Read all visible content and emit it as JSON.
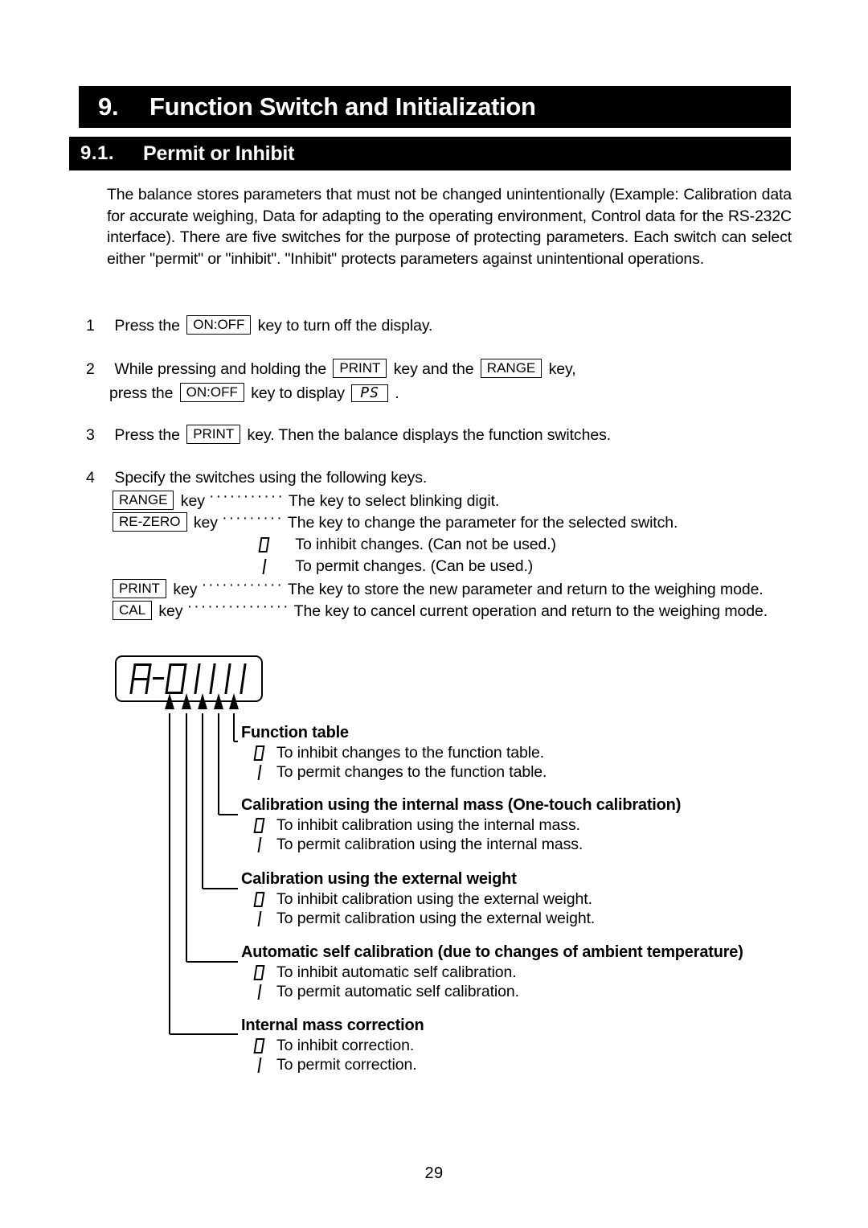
{
  "chapter": {
    "number": "9.",
    "title": "Function Switch and Initialization"
  },
  "section": {
    "number": "9.1.",
    "title": "Permit or Inhibit"
  },
  "intro": {
    "text": "The balance stores parameters that must not be changed unintentionally (Example: Calibration data for accurate weighing, Data for adapting to the operating environment, Control data for the RS-232C interface). There are five switches for the purpose of protecting parameters. Each switch can select either \"permit\" or \"inhibit\". \"Inhibit\" protects parameters against unintentional operations."
  },
  "steps": [
    {
      "number": "1",
      "pre": "Press the",
      "key1": "ON:OFF",
      "post": "key to turn off the display."
    },
    {
      "number": "2",
      "line1_pre": "While pressing and holding the",
      "line1_key1": "PRINT",
      "line1_mid": "key and the",
      "line1_key2": "RANGE",
      "line1_post": "key,",
      "line2_pre": "press the",
      "line2_key1": "ON:OFF",
      "line2_mid": "key to display",
      "line2_display": "PS",
      "line2_post": "."
    },
    {
      "number": "3",
      "pre": "Press the",
      "key1": "PRINT",
      "post": "key. Then the balance displays the function switches."
    },
    {
      "number": "4",
      "intro": "Specify the switches using the following keys."
    }
  ],
  "key_descriptions": [
    {
      "key": "RANGE",
      "word": "key",
      "leader": "···········",
      "text": "The key to select blinking digit."
    },
    {
      "key": "RE-ZERO",
      "word": "key",
      "leader": "·········",
      "text": "The key to change the parameter for the selected switch."
    },
    {
      "key": "PRINT",
      "word": "key",
      "leader": "············",
      "text": "The key to store the new parameter and return to the weighing mode."
    },
    {
      "key": "CAL",
      "word": "key",
      "leader": "···············",
      "text": "The key to cancel current operation and return to the weighing mode."
    }
  ],
  "rezero_options": [
    {
      "glyph": "0",
      "text": "To inhibit changes. (Can not be used.)"
    },
    {
      "glyph": "1",
      "text": "To permit changes. (Can be used.)"
    }
  ],
  "lcd": {
    "value": "A-01111",
    "glyphs": [
      "A",
      "-",
      "0",
      "1",
      "1",
      "1",
      "1"
    ]
  },
  "callouts": [
    {
      "title": "Function table",
      "rows": [
        {
          "glyph": "0",
          "text": "To inhibit changes to the function table."
        },
        {
          "glyph": "1",
          "text": "To permit changes to the function table."
        }
      ]
    },
    {
      "title": "Calibration using the internal mass (One-touch calibration)",
      "rows": [
        {
          "glyph": "0",
          "text": "To inhibit calibration using the internal mass."
        },
        {
          "glyph": "1",
          "text": "To permit calibration using the internal mass."
        }
      ]
    },
    {
      "title": "Calibration using the external weight",
      "rows": [
        {
          "glyph": "0",
          "text": "To inhibit calibration using the external weight."
        },
        {
          "glyph": "1",
          "text": "To permit calibration using the external weight."
        }
      ]
    },
    {
      "title": "Automatic self calibration (due to changes of ambient temperature)",
      "rows": [
        {
          "glyph": "0",
          "text": "To inhibit automatic self calibration."
        },
        {
          "glyph": "1",
          "text": "To permit automatic self calibration."
        }
      ]
    },
    {
      "title": "Internal mass correction",
      "rows": [
        {
          "glyph": "0",
          "text": "To inhibit correction."
        },
        {
          "glyph": "1",
          "text": "To permit correction."
        }
      ]
    }
  ],
  "page_number": "29"
}
